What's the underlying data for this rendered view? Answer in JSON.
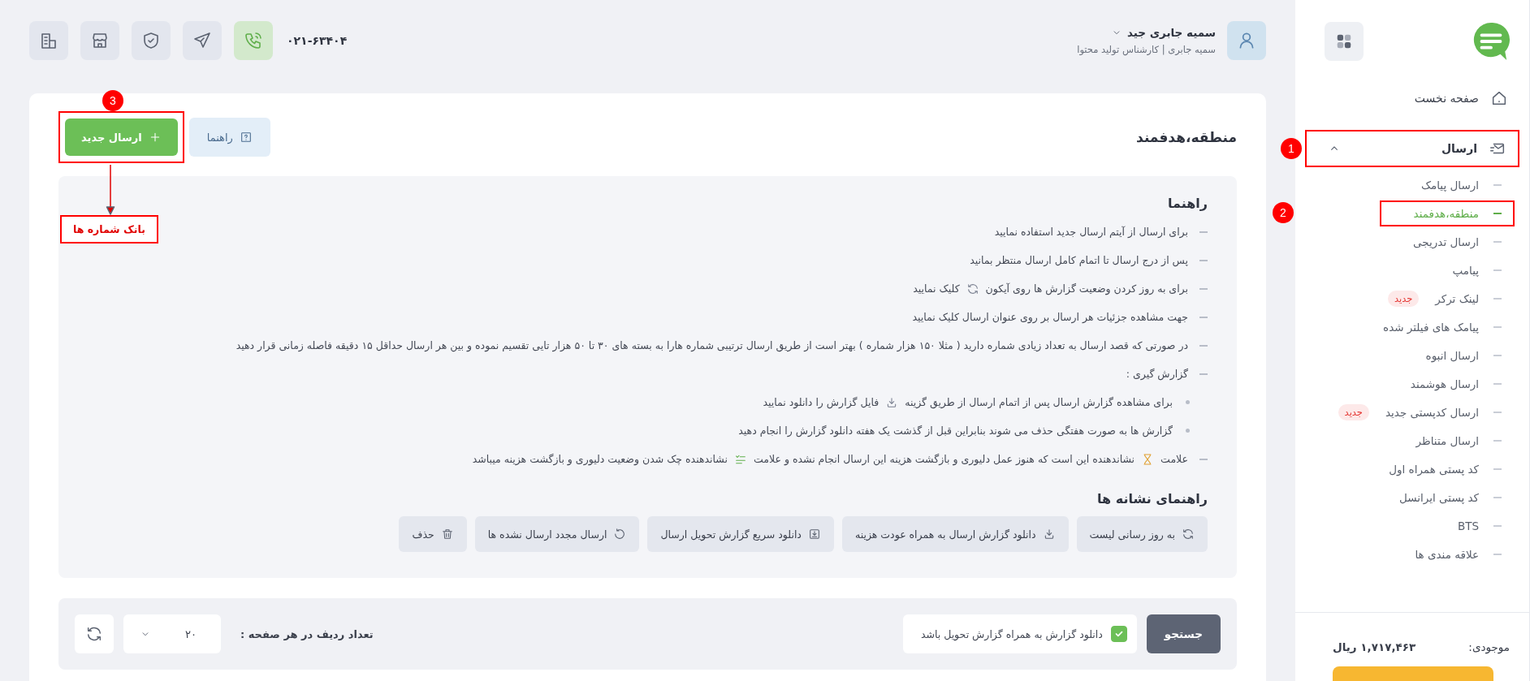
{
  "header": {
    "user": {
      "name": "سمیه جابری جید",
      "subtitle": "سمیه جابری | کارشناس تولید محتوا"
    },
    "phone": "۰۲۱-۶۳۴۰۴",
    "toolbar": [
      {
        "kind": "phone"
      },
      {
        "kind": "send"
      },
      {
        "kind": "shield"
      },
      {
        "kind": "store"
      },
      {
        "kind": "building"
      }
    ]
  },
  "page": {
    "title": "منطقه،هدفمند",
    "help_button": "راهنما",
    "new_button": {
      "label": "ارسال جدید",
      "annotation": "3",
      "callout": "بانک شماره ها"
    }
  },
  "guide": {
    "title": "راهنما",
    "items": [
      {
        "parts": [
          {
            "kind": "text",
            "text": "برای ارسال از آیتم ارسال جدید استفاده نمایید"
          }
        ]
      },
      {
        "parts": [
          {
            "kind": "text",
            "text": "پس از درج ارسال تا اتمام کامل ارسال منتظر بمانید"
          }
        ]
      },
      {
        "parts": [
          {
            "kind": "text",
            "text": "برای به روز کردن وضعیت گزارش ها روی آیکون"
          },
          {
            "kind": "refresh"
          },
          {
            "kind": "text",
            "text": "کلیک نمایید"
          }
        ]
      },
      {
        "parts": [
          {
            "kind": "text",
            "text": "جهت مشاهده جزئیات هر ارسال بر روی عنوان ارسال کلیک نمایید"
          }
        ]
      },
      {
        "parts": [
          {
            "kind": "text",
            "text": "در صورتی که قصد ارسال به تعداد زیادی شماره دارید ( مثلا ۱۵۰ هزار شماره ) بهتر است  از طریق ارسال ترتیبی شماره هارا به بسته های ۳۰ تا ۵۰ هزار تایی تقسیم نموده و بین هر ارسال حداقل ۱۵ دقیقه فاصله زمانی قرار دهید"
          }
        ]
      },
      {
        "parts": [
          {
            "kind": "text",
            "text": "گزارش گیری :"
          }
        ],
        "children": [
          {
            "parts": [
              {
                "kind": "text",
                "text": "برای مشاهده گزارش ارسال پس از اتمام ارسال از طریق گزینه"
              },
              {
                "kind": "download"
              },
              {
                "kind": "text",
                "text": "فایل گزارش را دانلود نمایید"
              }
            ]
          },
          {
            "parts": [
              {
                "kind": "text",
                "text": "گزارش ها به صورت هفتگی حذف می شوند بنابراین قبل از گذشت یک هفته دانلود گزارش را انجام دهید"
              }
            ]
          }
        ]
      },
      {
        "parts": [
          {
            "kind": "text",
            "text": "علامت"
          },
          {
            "kind": "hourglass"
          },
          {
            "kind": "text",
            "text": "نشاندهنده این است که هنوز عمل دلیوری و بازگشت هزینه این ارسال انجام نشده و علامت"
          },
          {
            "kind": "checklist"
          },
          {
            "kind": "text",
            "text": "نشاندهنده چک شدن وضعیت دلیوری و بازگشت هزینه میباشد"
          }
        ]
      }
    ],
    "legend_title": "راهنمای نشانه ها",
    "legend": [
      {
        "kind": "refresh",
        "label": "به روز رسانی لیست"
      },
      {
        "kind": "download",
        "label": "دانلود گزارش ارسال به همراه عودت هزینه"
      },
      {
        "kind": "download-box",
        "label": "دانلود سریع گزارش تحویل ارسال"
      },
      {
        "kind": "redo",
        "label": "ارسال مجدد ارسال نشده ها"
      },
      {
        "kind": "trash",
        "label": "حذف"
      }
    ]
  },
  "filters": {
    "search_button": "جستجو",
    "download_option": {
      "label": "دانلود گزارش به همراه گزارش تحویل باشد",
      "checked": true
    },
    "rows_label": "تعداد ردیف در هر صفحه :",
    "rows_value": "۲۰"
  },
  "sidebar": {
    "items": [
      {
        "kind": "link",
        "label": "صفحه نخست"
      },
      {
        "kind": "group",
        "label": "ارسال",
        "expanded": true,
        "annotation": "1",
        "children": [
          {
            "label": "ارسال پیامک",
            "selected": false
          },
          {
            "label": "منطقه،هدفمند",
            "selected": true,
            "annotation": "2"
          },
          {
            "label": "ارسال تدریجی",
            "selected": false
          },
          {
            "label": "پیامپ",
            "selected": false
          },
          {
            "label": "لینک ترکر",
            "selected": false,
            "badge": "جدید"
          },
          {
            "label": "پیامک های فیلتر شده",
            "selected": false
          },
          {
            "label": "ارسال انبوه",
            "selected": false
          },
          {
            "label": "ارسال هوشمند",
            "selected": false
          },
          {
            "label": "ارسال کدپستی جدید",
            "selected": false,
            "badge": "جدید"
          },
          {
            "label": "ارسال متناظر",
            "selected": false
          },
          {
            "label": "کد پستی همراه اول",
            "selected": false
          },
          {
            "label": "کد پستی ایرانسل",
            "selected": false
          },
          {
            "label": "BTS",
            "selected": false
          },
          {
            "label": "علاقه مندی ها",
            "selected": false
          }
        ]
      }
    ],
    "balance_label": "موجودی:",
    "balance_value": "۱,۷۱۷,۴۶۳ ریال"
  }
}
